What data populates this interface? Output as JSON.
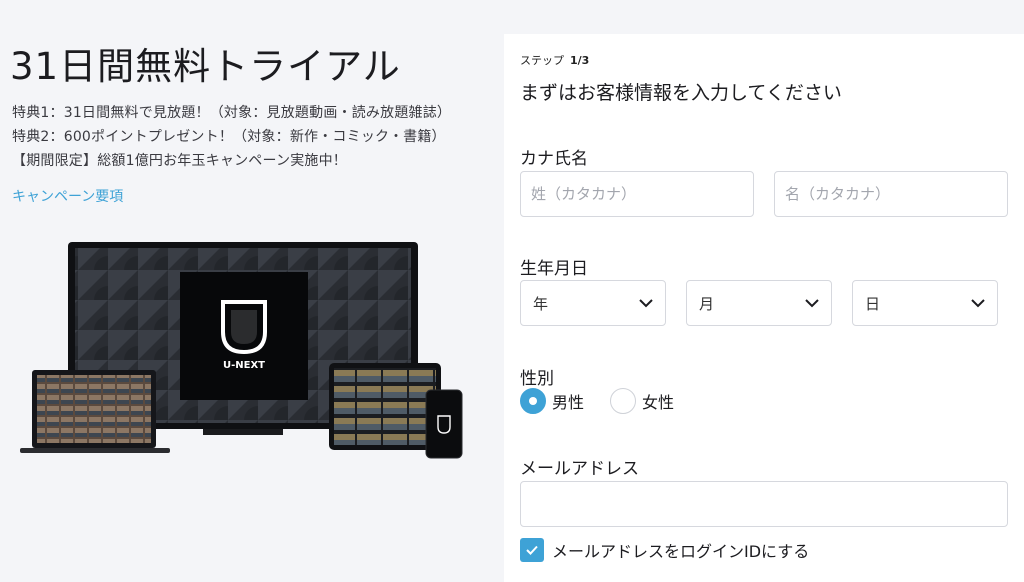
{
  "hero": {
    "title": "31日間無料トライアル",
    "benefits": [
      "特典1：31日間無料で見放題！（対象：見放題動画・読み放題雑誌）",
      "特典2：600ポイントプレゼント！（対象：新作・コミック・書籍）",
      "【期間限定】総額1億円お年玉キャンペーン実施中！"
    ],
    "campaign_link": "キャンペーン要項",
    "logo_text": "U-NEXT"
  },
  "form": {
    "step_label": "ステップ",
    "step_value": "1/3",
    "title": "まずはお客様情報を入力してください",
    "kana_label": "カナ氏名",
    "last_name_placeholder": "姓（カタカナ）",
    "first_name_placeholder": "名（カタカナ）",
    "birth_label": "生年月日",
    "year": "年",
    "month": "月",
    "day": "日",
    "gender_label": "性別",
    "male": "男性",
    "female": "女性",
    "email_label": "メールアドレス",
    "email_value": "",
    "login_id_checkbox": "メールアドレスをログインIDにする"
  },
  "colors": {
    "accent": "#3ea2d6",
    "background": "#f4f5f8",
    "panel": "#ffffff"
  }
}
